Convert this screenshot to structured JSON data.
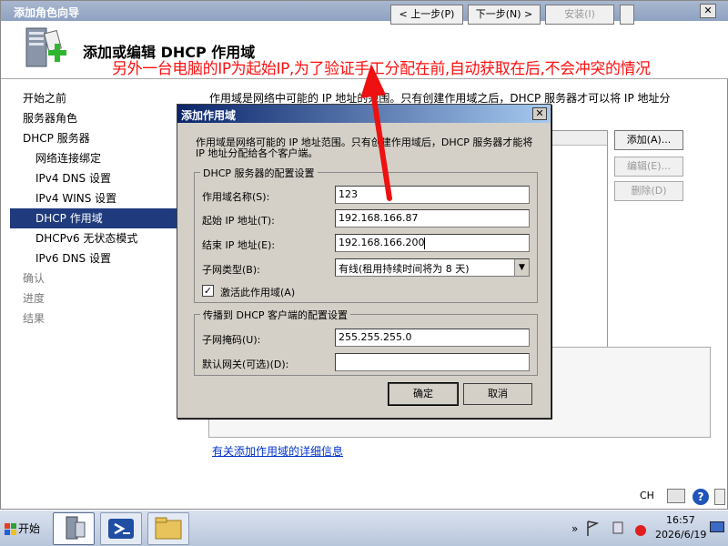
{
  "window": {
    "title": "添加角色向导",
    "close_label": "✕"
  },
  "header": {
    "heading": "添加或编辑 DHCP 作用域",
    "annotation": "另外一台电脑的IP为起始IP,为了验证手工分配在前,自动获取在后,不会冲突的情况"
  },
  "nav": {
    "items": [
      {
        "label": "开始之前"
      },
      {
        "label": "服务器角色"
      },
      {
        "label": "DHCP 服务器"
      },
      {
        "label": "网络连接绑定"
      },
      {
        "label": "IPv4 DNS 设置"
      },
      {
        "label": "IPv4 WINS 设置"
      },
      {
        "label": "DHCP 作用域"
      },
      {
        "label": "DHCPv6 无状态模式"
      },
      {
        "label": "IPv6 DNS 设置"
      },
      {
        "label": "确认"
      },
      {
        "label": "进度"
      },
      {
        "label": "结果"
      }
    ]
  },
  "content": {
    "intro": "作用域是网络中可能的 IP 地址的范围。只有创建作用域之后，DHCP 服务器才可以将 IP 地址分",
    "add_button": "添加(A)...",
    "edit_button": "编辑(E)...",
    "delete_button": "删除(D)",
    "learn_more_link": "有关添加作用域的详细信息"
  },
  "dialog": {
    "title": "添加作用域",
    "close_label": "✕",
    "description": "作用域是网络可能的 IP 地址范围。只有创建作用域后，DHCP 服务器才能将 IP 地址分配给各个客户端。",
    "settings_group": "DHCP 服务器的配置设置",
    "scope_name_label": "作用域名称(S):",
    "scope_name_value": "123",
    "start_ip_label": "起始 IP 地址(T):",
    "start_ip_value": "192.168.166.87",
    "end_ip_label": "结束 IP 地址(E):",
    "end_ip_value": "192.168.166.200",
    "subnet_type_label": "子网类型(B):",
    "subnet_type_value": "有线(租用持续时间将为 8 天)",
    "activate_label": "激活此作用域(A)",
    "activate_checked": "✓",
    "propagate_group": "传播到 DHCP 客户端的配置设置",
    "subnet_mask_label": "子网掩码(U):",
    "subnet_mask_value": "255.255.255.0",
    "gateway_label": "默认网关(可选)(D):",
    "gateway_value": "",
    "ok_button": "确定",
    "cancel_button": "取消"
  },
  "wizard_buttons": {
    "prev": "< 上一步(P)",
    "next": "下一步(N) >",
    "install": "安装(I)",
    "ime_lang": "CH",
    "help_glyph": "?"
  },
  "taskbar": {
    "start_label": "开始",
    "apps": [
      "server-manager",
      "powershell",
      "file-explorer"
    ],
    "clock_time": "16:57",
    "clock_date": "2026/6/19"
  },
  "colors": {
    "annotation": "#ff1010",
    "arrow": "#ee1111",
    "nav_selected": "#1f3a7d",
    "dialog_titlebar": "#0a246a"
  }
}
